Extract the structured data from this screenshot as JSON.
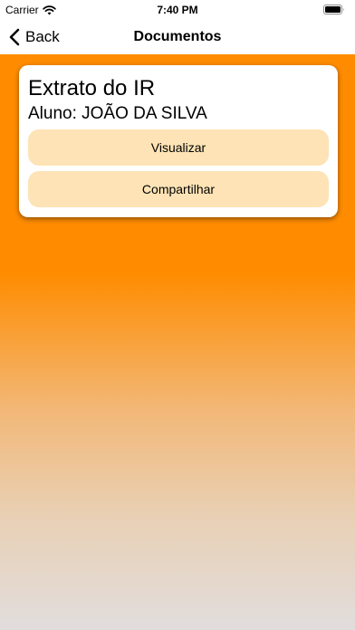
{
  "status_bar": {
    "carrier": "Carrier",
    "time": "7:40 PM",
    "wifi_icon": "wifi-icon",
    "battery_icon": "battery-icon"
  },
  "nav": {
    "back_label": "Back",
    "back_icon": "chevron-left-icon",
    "title": "Documentos"
  },
  "colors": {
    "background_top": "#ff8c00",
    "background_bottom": "#e1dddd",
    "button_bg": "#fde3b5",
    "card_bg": "#ffffff"
  },
  "card": {
    "title": "Extrato do IR",
    "subtitle": "Aluno: JOÃO DA SILVA",
    "view_label": "Visualizar",
    "share_label": "Compartilhar"
  }
}
